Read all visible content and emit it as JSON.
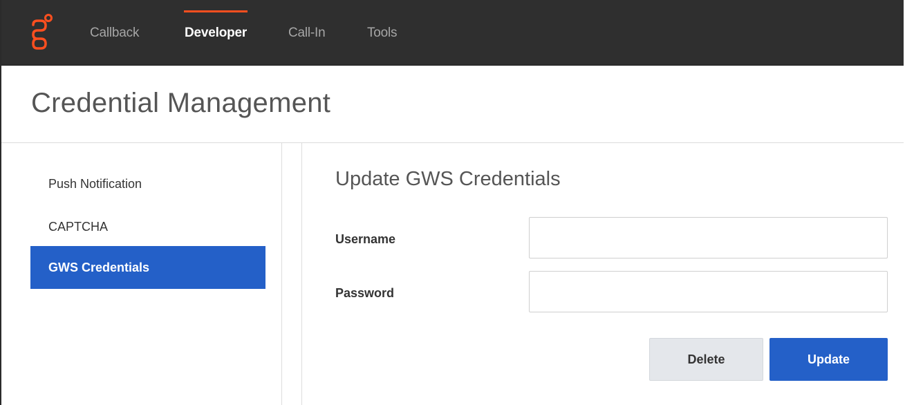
{
  "nav": {
    "items": [
      {
        "label": "Callback"
      },
      {
        "label": "Developer"
      },
      {
        "label": "Call-In"
      },
      {
        "label": "Tools"
      }
    ],
    "active_index": 1,
    "accent_color": "#ff4f1f"
  },
  "page": {
    "title": "Credential Management"
  },
  "sidebar": {
    "items": [
      {
        "label": "Push Notification"
      },
      {
        "label": "CAPTCHA"
      },
      {
        "label": "GWS Credentials"
      }
    ],
    "active_index": 2,
    "active_color": "#2460c8"
  },
  "form": {
    "title": "Update GWS Credentials",
    "username": {
      "label": "Username",
      "value": ""
    },
    "password": {
      "label": "Password",
      "value": ""
    },
    "delete_label": "Delete",
    "update_label": "Update"
  },
  "icons": {
    "logo": "genesys-logo-icon"
  }
}
